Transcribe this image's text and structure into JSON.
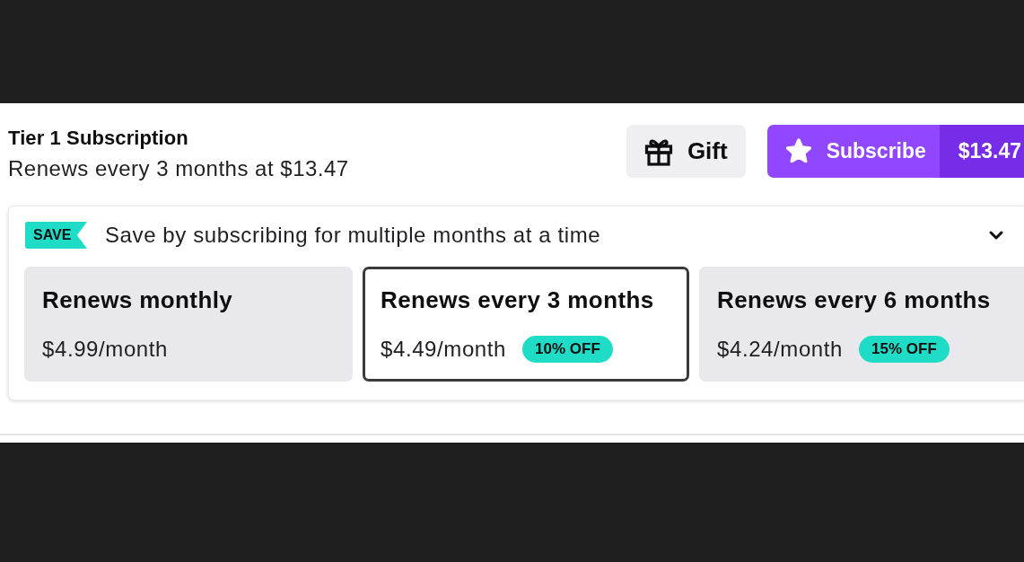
{
  "header": {
    "title": "Tier 1 Subscription",
    "subtitle": "Renews every 3 months at $13.47"
  },
  "actions": {
    "gift": {
      "label": "Gift"
    },
    "subscribe": {
      "label": "Subscribe",
      "price": "$13.47"
    }
  },
  "savings": {
    "badge": "SAVE",
    "message": "Save by subscribing for multiple months at a time",
    "expanded": true
  },
  "plans": [
    {
      "title": "Renews monthly",
      "price": "$4.99/month",
      "selected": false
    },
    {
      "title": "Renews every 3 months",
      "price": "$4.49/month",
      "discount": "10% OFF",
      "selected": true
    },
    {
      "title": "Renews every 6 months",
      "price": "$4.24/month",
      "discount": "15% OFF",
      "selected": false
    }
  ]
}
